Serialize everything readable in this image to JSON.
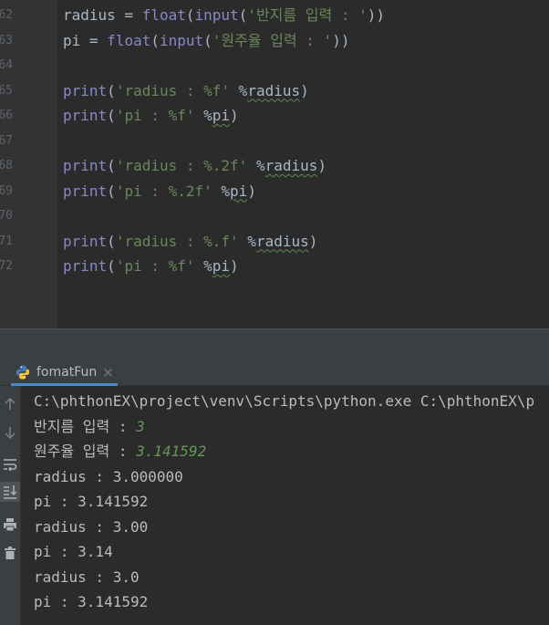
{
  "editor": {
    "lines": [
      {
        "num": "62",
        "parts": [
          {
            "t": "radius = ",
            "c": "pl"
          },
          {
            "t": "float",
            "c": "kw"
          },
          {
            "t": "(",
            "c": "pl"
          },
          {
            "t": "input",
            "c": "kw"
          },
          {
            "t": "(",
            "c": "pl"
          },
          {
            "t": "'반지름 입력 : '",
            "c": "str"
          },
          {
            "t": "))",
            "c": "pl"
          }
        ]
      },
      {
        "num": "63",
        "parts": [
          {
            "t": "pi = ",
            "c": "pl"
          },
          {
            "t": "float",
            "c": "kw"
          },
          {
            "t": "(",
            "c": "pl"
          },
          {
            "t": "input",
            "c": "kw"
          },
          {
            "t": "(",
            "c": "pl"
          },
          {
            "t": "'원주율 입력 : '",
            "c": "str"
          },
          {
            "t": "))",
            "c": "pl"
          }
        ]
      },
      {
        "num": "64",
        "parts": []
      },
      {
        "num": "65",
        "parts": [
          {
            "t": "print",
            "c": "kw"
          },
          {
            "t": "(",
            "c": "pl"
          },
          {
            "t": "'radius : %f'",
            "c": "str"
          },
          {
            "t": " %",
            "c": "pl"
          },
          {
            "t": "radius",
            "c": "var"
          },
          {
            "t": ")",
            "c": "pl"
          }
        ]
      },
      {
        "num": "66",
        "parts": [
          {
            "t": "print",
            "c": "kw"
          },
          {
            "t": "(",
            "c": "pl"
          },
          {
            "t": "'pi : %f'",
            "c": "str"
          },
          {
            "t": " %",
            "c": "pl"
          },
          {
            "t": "pi",
            "c": "var"
          },
          {
            "t": ")",
            "c": "pl"
          }
        ]
      },
      {
        "num": "67",
        "parts": []
      },
      {
        "num": "68",
        "parts": [
          {
            "t": "print",
            "c": "kw"
          },
          {
            "t": "(",
            "c": "pl"
          },
          {
            "t": "'radius : %.2f'",
            "c": "str"
          },
          {
            "t": " %",
            "c": "pl"
          },
          {
            "t": "radius",
            "c": "var"
          },
          {
            "t": ")",
            "c": "pl"
          }
        ]
      },
      {
        "num": "69",
        "parts": [
          {
            "t": "print",
            "c": "kw"
          },
          {
            "t": "(",
            "c": "pl"
          },
          {
            "t": "'pi : %.2f'",
            "c": "str"
          },
          {
            "t": " %",
            "c": "pl"
          },
          {
            "t": "pi",
            "c": "var"
          },
          {
            "t": ")",
            "c": "pl"
          }
        ]
      },
      {
        "num": "70",
        "parts": []
      },
      {
        "num": "71",
        "parts": [
          {
            "t": "print",
            "c": "kw"
          },
          {
            "t": "(",
            "c": "pl"
          },
          {
            "t": "'radius : %.f'",
            "c": "str"
          },
          {
            "t": " %",
            "c": "pl"
          },
          {
            "t": "radius",
            "c": "var"
          },
          {
            "t": ")",
            "c": "pl"
          }
        ]
      },
      {
        "num": "72",
        "parts": [
          {
            "t": "print",
            "c": "kw"
          },
          {
            "t": "(",
            "c": "pl"
          },
          {
            "t": "'pi : %f'",
            "c": "str"
          },
          {
            "t": " %",
            "c": "pl"
          },
          {
            "t": "pi",
            "c": "var"
          },
          {
            "t": ")",
            "c": "pl"
          }
        ]
      }
    ]
  },
  "run_panel": {
    "tab_label": "fomatFun",
    "tab_icon": "python-icon",
    "close_glyph": "×",
    "toolbar_icons": [
      "arrow-up-icon",
      "arrow-down-icon",
      "soft-wrap-icon",
      "scroll-to-end-icon",
      "print-icon",
      "trash-icon"
    ]
  },
  "console": {
    "lines": [
      {
        "text": "C:\\phthonEX\\project\\venv\\Scripts\\python.exe C:\\phthonEX\\p",
        "input": ""
      },
      {
        "text": "반지름 입력 : ",
        "input": "3"
      },
      {
        "text": "원주율 입력 : ",
        "input": "3.141592"
      },
      {
        "text": "radius : 3.000000",
        "input": ""
      },
      {
        "text": "pi : 3.141592",
        "input": ""
      },
      {
        "text": "radius : 3.00",
        "input": ""
      },
      {
        "text": "pi : 3.14",
        "input": ""
      },
      {
        "text": "radius : 3.0",
        "input": ""
      },
      {
        "text": "pi : 3.141592",
        "input": ""
      }
    ]
  },
  "colors": {
    "keyword": "#8888c6",
    "string": "#6a8759",
    "plain": "#a9b7c6",
    "user_input": "#629755",
    "tab_underline": "#4a88c7"
  }
}
